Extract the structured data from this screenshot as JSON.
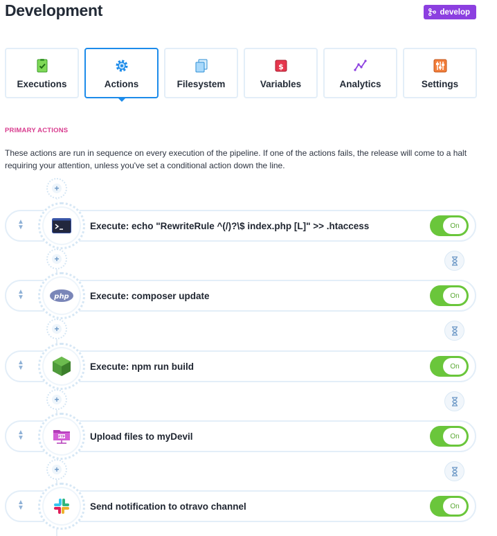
{
  "header": {
    "title": "Development",
    "branch": "develop",
    "accent_color": "#8c3fe0"
  },
  "tabs": [
    {
      "label": "Executions",
      "icon": "clipboard-check-icon",
      "active": false
    },
    {
      "label": "Actions",
      "icon": "gear-icon",
      "active": true
    },
    {
      "label": "Filesystem",
      "icon": "files-icon",
      "active": false
    },
    {
      "label": "Variables",
      "icon": "dollar-icon",
      "active": false
    },
    {
      "label": "Analytics",
      "icon": "line-chart-icon",
      "active": false
    },
    {
      "label": "Settings",
      "icon": "sliders-icon",
      "active": false
    }
  ],
  "section": {
    "title": "PRIMARY ACTIONS",
    "description": "These actions are run in sequence on every execution of the pipeline. If one of the actions fails, the release will come to a halt requiring your attention, unless you've set a conditional action down the line."
  },
  "actions": [
    {
      "name": "Execute: echo \"RewriteRule ^(/)?\\$ index.php [L]\" >> .htaccess",
      "icon": "terminal-icon",
      "toggle": "On"
    },
    {
      "name": "Execute: composer update",
      "icon": "php-icon",
      "toggle": "On"
    },
    {
      "name": "Execute: npm run build",
      "icon": "nodejs-icon",
      "toggle": "On"
    },
    {
      "name": "Upload files to myDevil",
      "icon": "ftp-folder-icon",
      "toggle": "On"
    },
    {
      "name": "Send notification to otravo channel",
      "icon": "slack-icon",
      "toggle": "On"
    }
  ],
  "colors": {
    "active_tab_border": "#1c8bea",
    "section_title": "#d83b8e",
    "toggle_on": "#6ac63b"
  }
}
